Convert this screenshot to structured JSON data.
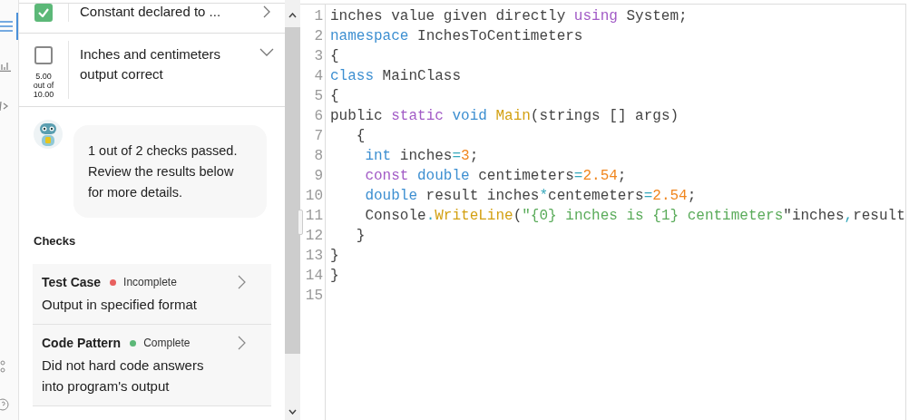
{
  "rail": {
    "items": [
      {
        "kind": "list",
        "selected": true
      },
      {
        "kind": "chart",
        "selected": false
      },
      {
        "kind": "code",
        "selected": false
      },
      {
        "kind": "nodes",
        "selected": false
      },
      {
        "kind": "help",
        "selected": false
      }
    ]
  },
  "criteria": [
    {
      "label": "Constant declared to ...",
      "checked": true,
      "expanded": false
    },
    {
      "label": "Inches and centimeters output correct",
      "checked": false,
      "expanded": true,
      "score": "5.00 out of 10.00"
    }
  ],
  "feedback": {
    "message": "1 out of 2 checks passed. Review the results below for more details."
  },
  "checks": {
    "heading": "Checks",
    "items": [
      {
        "type": "Test Case",
        "status": "Incomplete",
        "color": "#e8605f",
        "description": "Output in specified format"
      },
      {
        "type": "Code Pattern",
        "status": "Complete",
        "color": "#5cb878",
        "description": "Did not hard code answers into program's output"
      }
    ]
  },
  "editor": {
    "lines": [
      {
        "number": "1",
        "tokens": [
          {
            "t": "inches value given directly ",
            "kind": "plain"
          },
          {
            "t": "using",
            "kind": "keyword2"
          },
          {
            "t": " System;",
            "kind": "plain"
          }
        ]
      },
      {
        "number": "2",
        "tokens": [
          {
            "t": "namespace",
            "kind": "keyword"
          },
          {
            "t": " InchesToCentimeters",
            "kind": "plain"
          }
        ]
      },
      {
        "number": "3",
        "tokens": [
          {
            "t": "{",
            "kind": "plain"
          }
        ]
      },
      {
        "number": "4",
        "tokens": [
          {
            "t": "class",
            "kind": "keyword"
          },
          {
            "t": " MainClass",
            "kind": "plain"
          }
        ]
      },
      {
        "number": "5",
        "tokens": [
          {
            "t": "{",
            "kind": "plain"
          }
        ]
      },
      {
        "number": "6",
        "tokens": [
          {
            "t": "public ",
            "kind": "plain"
          },
          {
            "t": "static ",
            "kind": "keyword2"
          },
          {
            "t": "void ",
            "kind": "keyword"
          },
          {
            "t": "Main",
            "kind": "function"
          },
          {
            "t": "(strings [] args)",
            "kind": "plain"
          }
        ]
      },
      {
        "number": "7",
        "tokens": [
          {
            "t": "   {",
            "kind": "plain"
          }
        ]
      },
      {
        "number": "8",
        "tokens": [
          {
            "t": "    int",
            "kind": "keyword"
          },
          {
            "t": " inches",
            "kind": "plain"
          },
          {
            "t": "=",
            "kind": "operator"
          },
          {
            "t": "3",
            "kind": "number"
          },
          {
            "t": ";",
            "kind": "plain"
          }
        ]
      },
      {
        "number": "9",
        "tokens": [
          {
            "t": "    const ",
            "kind": "keyword2"
          },
          {
            "t": "double",
            "kind": "keyword"
          },
          {
            "t": " centimeters",
            "kind": "plain"
          },
          {
            "t": "=",
            "kind": "operator"
          },
          {
            "t": "2.54",
            "kind": "number"
          },
          {
            "t": ";",
            "kind": "plain"
          }
        ]
      },
      {
        "number": "10",
        "tokens": [
          {
            "t": "    double",
            "kind": "keyword"
          },
          {
            "t": " result inches",
            "kind": "plain"
          },
          {
            "t": "*",
            "kind": "operator"
          },
          {
            "t": "centemeters",
            "kind": "plain"
          },
          {
            "t": "=",
            "kind": "operator"
          },
          {
            "t": "2.54",
            "kind": "number"
          },
          {
            "t": ";",
            "kind": "plain"
          }
        ]
      },
      {
        "number": "11",
        "tokens": [
          {
            "t": "    Console",
            "kind": "plain"
          },
          {
            "t": ".",
            "kind": "operator"
          },
          {
            "t": "WriteLine",
            "kind": "function"
          },
          {
            "t": "(",
            "kind": "plain"
          },
          {
            "t": "\"{0} inches is {1} centimeters",
            "kind": "string"
          },
          {
            "t": "\"inches",
            "kind": "plain"
          },
          {
            "t": ",",
            "kind": "operator"
          },
          {
            "t": "result",
            "kind": "plain"
          }
        ]
      },
      {
        "number": "12",
        "tokens": [
          {
            "t": "   }",
            "kind": "plain"
          }
        ]
      },
      {
        "number": "13",
        "tokens": [
          {
            "t": "}",
            "kind": "plain"
          }
        ]
      },
      {
        "number": "14",
        "tokens": [
          {
            "t": "}",
            "kind": "plain"
          }
        ]
      },
      {
        "number": "15"
      }
    ]
  }
}
